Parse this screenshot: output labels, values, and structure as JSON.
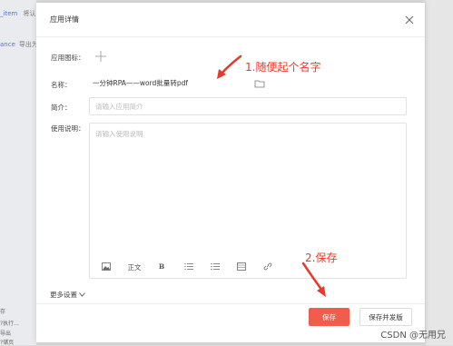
{
  "background": {
    "item1": "_item",
    "item1_rest": "将认",
    "item2": "ance",
    "item2_rest": "导出为",
    "bottom_items": [
      "存",
      "?执行...",
      "导出",
      "?储页"
    ]
  },
  "modal": {
    "title": "应用详情",
    "icon_label": "应用图标：",
    "name_label": "名称：",
    "name_value": "一分钟RPA——word批量转pdf",
    "brief_label": "简介：",
    "brief_placeholder": "请输入应用简介",
    "instructions_label": "使用说明：",
    "instructions_placeholder": "请输入使用说明",
    "toolbar": {
      "text_style": "正文",
      "bold": "B"
    },
    "more_settings": "更多设置",
    "save_button": "保存",
    "save_publish_button": "保存并发版"
  },
  "annotations": {
    "note1": "1.随便起个名字",
    "note2": "2.保存",
    "color": "#e53a2e"
  },
  "watermark": "CSDN @无用兄"
}
